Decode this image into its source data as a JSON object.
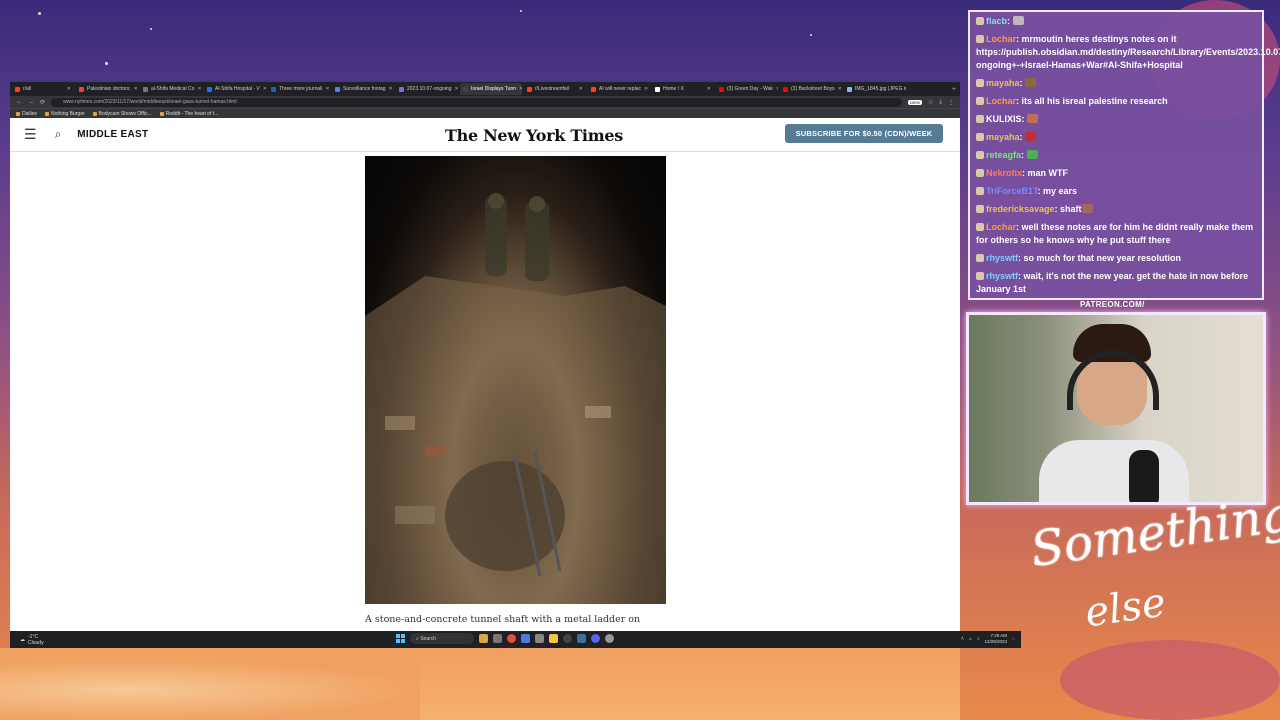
{
  "browser": {
    "tabs": [
      {
        "label": "r/all",
        "color": "#ff4500"
      },
      {
        "label": "Palestinian doctors:",
        "color": "#ea4335"
      },
      {
        "label": "al-Shifa Medical Co",
        "color": "#777777"
      },
      {
        "label": "Al-Shifa Hospital - V",
        "color": "#1a73e8"
      },
      {
        "label": "Three more journali",
        "color": "#1565c0"
      },
      {
        "label": "Surveillance footag",
        "color": "#4285f4"
      },
      {
        "label": "2023.10.07-ongoing",
        "color": "#7b68ee"
      },
      {
        "label": "Israel Displays Tunn",
        "color": "#444444"
      },
      {
        "label": "r/Livestreamfail",
        "color": "#ff4500"
      },
      {
        "label": "AI will never replac",
        "color": "#ff4500"
      },
      {
        "label": "Home / X",
        "color": "#ffffff"
      },
      {
        "label": "(3) Green Day - Wak",
        "color": "#ff0000"
      },
      {
        "label": "(3) Backstreet Boys",
        "color": "#ff0000"
      },
      {
        "label": "IMG_1845.jpg (JPEG ima",
        "color": "#8ab4f8"
      }
    ],
    "active_tab": 7,
    "url": "www.nytimes.com/2023/11/17/world/middleeast/israel-gaza-tunnel-hamas.html",
    "zoom": "100%",
    "bookmarks": [
      "Dailies",
      "Nothing Burger",
      "Bodycam Shows Offic...",
      "Reddit - The heart of t..."
    ]
  },
  "nyt": {
    "section": "MIDDLE EAST",
    "masthead": "The New York Times",
    "subscribe": "SUBSCRIBE FOR $0.50 (CDN)/WEEK",
    "account": "A",
    "caption": "A stone-and-concrete tunnel shaft with a metal ladder on"
  },
  "taskbar": {
    "weather_temp": "-1°C",
    "weather_desc": "Cloudy",
    "search": "Search",
    "time": "7:29 AM",
    "date": "12/28/2023"
  },
  "chat": [
    {
      "user": "flacb",
      "text": "",
      "color": "#7ee0e0",
      "emote": "#bbbbbb"
    },
    {
      "user": "Lochar",
      "text": "mrmoutin heres destinys notes on it https://publish.obsidian.md/destiny/Research/Library/Events/2023.10.07-ongoing+-+Israel-Hamas+War#Al-Shifa+Hospital",
      "color": "#ff9a3c"
    },
    {
      "user": "mayaha",
      "text": "",
      "color": "#e8c25a",
      "emote": "#8a6a3a"
    },
    {
      "user": "Lochar",
      "text": "its all his isreal palestine research",
      "color": "#ff9a3c"
    },
    {
      "user": "KULIXIS",
      "text": "",
      "color": "#ffffff",
      "emote": "#c07050"
    },
    {
      "user": "mayaha",
      "text": "",
      "color": "#e8c25a",
      "emote": "#c03030"
    },
    {
      "user": "reteagfa",
      "text": "",
      "color": "#6cf06c",
      "emote": "#4caf50"
    },
    {
      "user": "Nekrotix",
      "text": "man WTF",
      "color": "#ff7a5a"
    },
    {
      "user": "TriForceB1T",
      "text": "my ears",
      "color": "#7a8cff"
    },
    {
      "user": "fredericksavage",
      "text": "shaft",
      "color": "#e8c25a",
      "emote": "#a06a5a"
    },
    {
      "user": "Lochar",
      "text": "well these notes are for him he didnt really make them for others so he knows why he put stuff there",
      "color": "#ff9a3c"
    },
    {
      "user": "rhyswtf",
      "text": "so much for that new year resolution",
      "color": "#7ad0ff"
    },
    {
      "user": "rhyswtf",
      "text": "wait, it's not the new year. get the hate in now before January 1st",
      "color": "#7ad0ff"
    }
  ],
  "overlay": {
    "patreon": "PATREON.COM/",
    "brand_line1": "Something",
    "brand_line2": "else"
  }
}
